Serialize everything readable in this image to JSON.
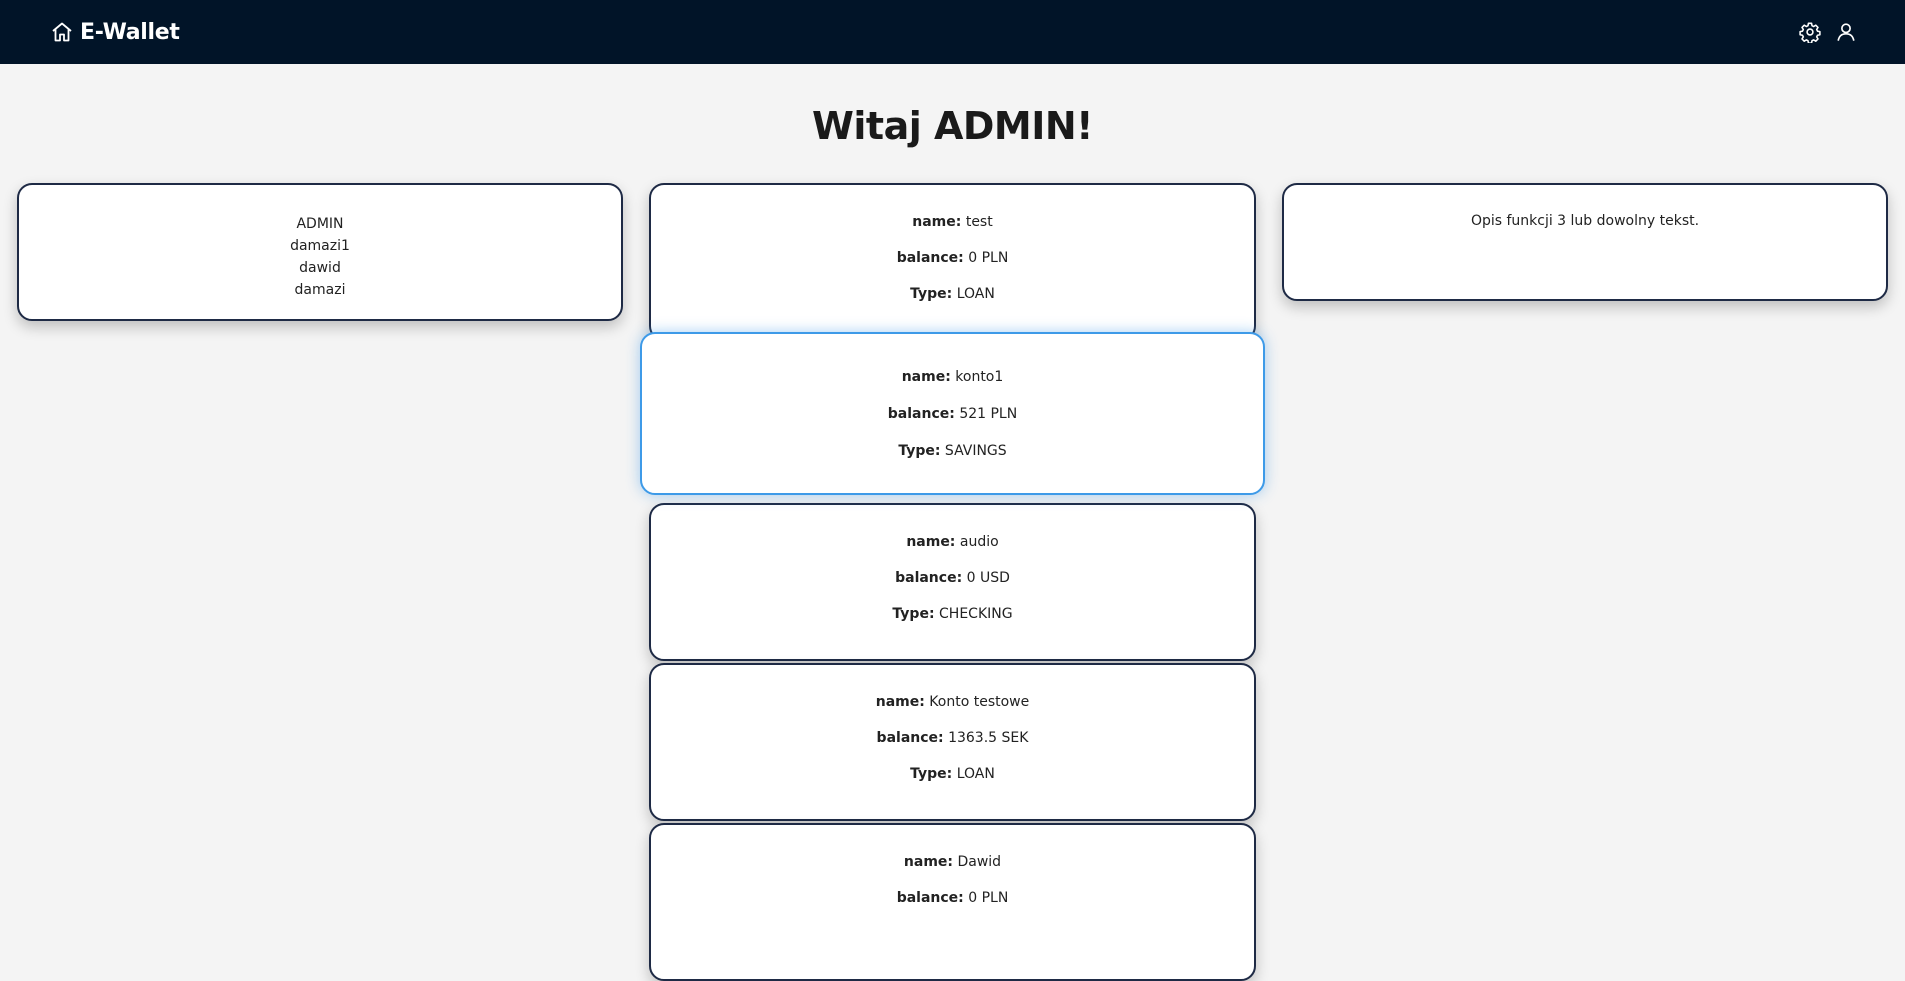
{
  "app": {
    "brand": "E-Wallet"
  },
  "page": {
    "title": "Witaj ADMIN!"
  },
  "users": [
    "ADMIN",
    "damazi1",
    "dawid",
    "damazi"
  ],
  "info": {
    "text": "Opis funkcji 3 lub dowolny tekst."
  },
  "labels": {
    "name": "name:",
    "balance": "balance:",
    "type": "Type:"
  },
  "accounts": [
    {
      "name": "test",
      "balance": "0 PLN",
      "type": "LOAN"
    },
    {
      "name": "konto1",
      "balance": "521 PLN",
      "type": "SAVINGS"
    },
    {
      "name": "audio",
      "balance": "0 USD",
      "type": "CHECKING"
    },
    {
      "name": "Konto testowe",
      "balance": "1363.5 SEK",
      "type": "LOAN"
    },
    {
      "name": "Dawid",
      "balance": "0 PLN",
      "type": ""
    }
  ],
  "icons": {
    "home": "home-icon",
    "settings": "gear-icon",
    "profile": "user-icon"
  },
  "colors": {
    "navbar": "#011428",
    "background": "#f4f4f4",
    "card_border": "#1e2a45",
    "active_border": "#3d9ae8"
  }
}
